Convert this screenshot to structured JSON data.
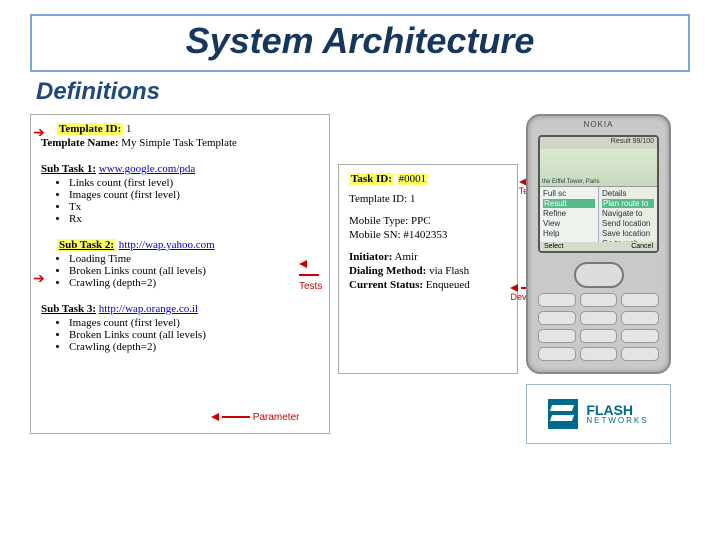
{
  "title": "System Architecture",
  "subtitle": "Definitions",
  "template_panel": {
    "template_id_label": "Template ID:",
    "template_id_value": "1",
    "template_name_label": "Template Name:",
    "template_name_value": "My Simple Task Template",
    "sub1_label": "Sub Task 1:",
    "sub1_url": "www.google.com/pda",
    "sub1_items": [
      "Links count (first level)",
      "Images count (first level)",
      "Tx",
      "Rx"
    ],
    "sub2_label": "Sub Task 2:",
    "sub2_url": "http://wap.yahoo.com",
    "sub2_items": [
      "Loading Time",
      "Broken Links count (all levels)",
      "Crawling (depth=2)"
    ],
    "sub3_label": "Sub Task 3:",
    "sub3_url": "http://wap.orange.co.il",
    "sub3_items": [
      "Images count (first level)",
      "Broken Links count (all levels)",
      "Crawling (depth=2)"
    ],
    "callout_tests": "Tests",
    "callout_param": "Parameter"
  },
  "task_panel": {
    "task_id_label": "Task ID:",
    "task_id_value": "#0001",
    "template_id_label": "Template ID:",
    "template_id_value": "1",
    "mobile_type_label": "Mobile Type:",
    "mobile_type_value": "PPC",
    "mobile_sn_label": "Mobile SN:",
    "mobile_sn_value": "#1402353",
    "initiator_label": "Initiator:",
    "initiator_value": "Amir",
    "dialing_label": "Dialing Method:",
    "dialing_value": "via Flash",
    "status_label": "Current Status:",
    "status_value": "Enqueued",
    "callout_from_template": "from Task\nTemplate",
    "callout_from_device": "from Mobile\nDevices"
  },
  "phone": {
    "brand": "NOKIA",
    "result": "Result 99/100",
    "map_label": "the Eiffel Tower, Paris",
    "left_menu": [
      "Full sc",
      "Result",
      "Refine",
      "View",
      "Help"
    ],
    "right_menu": [
      "Details",
      "Plan route to",
      "Navigate to",
      "Send location",
      "Save location",
      "Go to web address"
    ],
    "soft_left": "Select",
    "soft_right": "Cancel"
  },
  "logo": {
    "name": "FLASH",
    "sub": "NETWORKS"
  }
}
